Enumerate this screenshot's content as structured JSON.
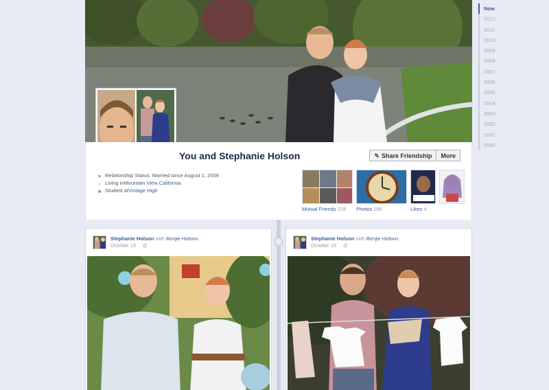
{
  "profile": {
    "friendship_title": "You and Stephanie Holson",
    "buttons": {
      "share": "Share Friendship",
      "more": "More"
    },
    "facts": [
      {
        "icon": "heart-icon",
        "prefix": "Relationship Status: Married since August 1, 2009",
        "link": "",
        "mid": "",
        "link2": ""
      },
      {
        "icon": "home-icon",
        "prefix": "Living in ",
        "link": "Mountain View",
        "mid": ", ",
        "link2": "California"
      },
      {
        "icon": "school-icon",
        "prefix": "Studied at ",
        "link": "Vintage High",
        "mid": "",
        "link2": ""
      }
    ],
    "thumbs": {
      "mutual_label": "Mutual Friends",
      "mutual_count": "218",
      "photos_label": "Photos",
      "photos_count": "285",
      "likes_label": "Likes",
      "likes_count": "4"
    }
  },
  "timeline_years": [
    "Now",
    "2012",
    "2011",
    "2010",
    "2009",
    "2008",
    "2007",
    "2006",
    "2005",
    "2004",
    "2003",
    "2002",
    "2001",
    "2000"
  ],
  "posts": [
    {
      "author": "Stephanie Holson",
      "with_text": "with",
      "with_name": "Benjie Holson.",
      "date": "October 19",
      "privacy": "⛭"
    },
    {
      "author": "Stephanie Holson",
      "with_text": "with",
      "with_name": "Benjie Holson.",
      "date": "October 19",
      "privacy": "⛭"
    }
  ],
  "colors": {
    "link": "#3b5998",
    "background": "#e8ebf3",
    "title": "#1c2a47"
  }
}
